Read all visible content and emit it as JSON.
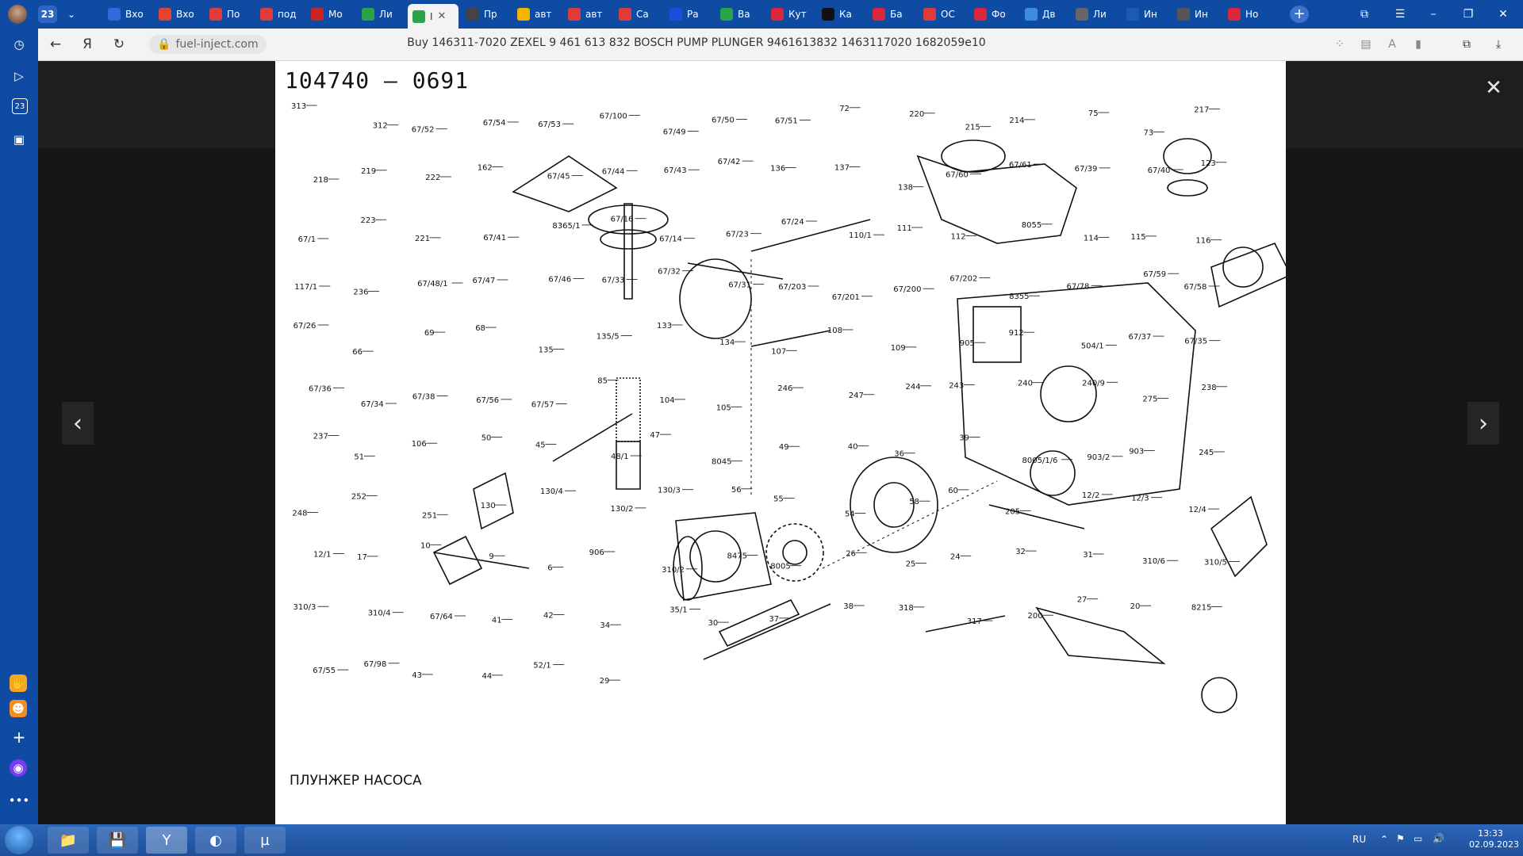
{
  "browser": {
    "tab_count": "23",
    "tabs": [
      {
        "label": "Вхо",
        "color": "#2f6bd8",
        "icon": "mail-icon"
      },
      {
        "label": "Вхо",
        "color": "#e2442f",
        "icon": "gmail-icon"
      },
      {
        "label": "По",
        "color": "#e03b3b",
        "icon": "flag-icon"
      },
      {
        "label": "под",
        "color": "#e03b3b",
        "icon": "yandex-icon"
      },
      {
        "label": "Мо",
        "color": "#c22",
        "icon": "news-icon"
      },
      {
        "label": "Ли",
        "color": "#2aa34a",
        "icon": "people-icon"
      },
      {
        "label": "I",
        "color": "#2aa34a",
        "icon": "leaf-icon",
        "active": true
      },
      {
        "label": "Пр",
        "color": "#444",
        "icon": "doc-icon"
      },
      {
        "label": "авт",
        "color": "#f2b600",
        "icon": "chart-icon"
      },
      {
        "label": "авт",
        "color": "#e03b3b",
        "icon": "yandex-icon"
      },
      {
        "label": "Са",
        "color": "#e03b3b",
        "icon": "map-pin-icon"
      },
      {
        "label": "Ра",
        "color": "#1c4ed8",
        "icon": "a-icon"
      },
      {
        "label": "Ва",
        "color": "#2aa34a",
        "icon": "link-icon"
      },
      {
        "label": "Кут",
        "color": "#d8263b",
        "icon": "play-icon"
      },
      {
        "label": "Ка",
        "color": "#111",
        "icon": "star-icon"
      },
      {
        "label": "Ба",
        "color": "#d8263b",
        "icon": "pen-icon"
      },
      {
        "label": "ОС",
        "color": "#e03b3b",
        "icon": "yandex-icon"
      },
      {
        "label": "Фо",
        "color": "#d8263b",
        "icon": "photo-icon"
      },
      {
        "label": "Дв",
        "color": "#3a8de0",
        "icon": "arrow-icon"
      },
      {
        "label": "Ли",
        "color": "#666",
        "icon": "location-icon"
      },
      {
        "label": "Ин",
        "color": "#1a5ab8",
        "icon": "f-icon"
      },
      {
        "label": "Ин",
        "color": "#555",
        "icon": "speaker-icon"
      },
      {
        "label": "Но",
        "color": "#d8263b",
        "icon": "d-icon"
      }
    ],
    "url": "fuel-inject.com",
    "page_title": "Buy 146311-7020 ZEXEL 9 461 613 832 BOSCH PUMP PLUNGER 9461613832 1463117020 1682059e10"
  },
  "sidebar": {
    "badge": "23"
  },
  "viewer": {
    "diagram_title": "104740 — 0691",
    "caption": "ПЛУНЖЕР НАСОСА",
    "part_labels": [
      "313",
      "312",
      "67/52",
      "67/54",
      "67/53",
      "67/100",
      "67/49",
      "67/50",
      "67/51",
      "72",
      "220",
      "215",
      "214",
      "75",
      "73",
      "217",
      "218",
      "219",
      "222",
      "162",
      "67/45",
      "67/44",
      "67/43",
      "67/42",
      "136",
      "137",
      "138",
      "67/60",
      "67/61",
      "67/39",
      "67/40",
      "123",
      "67/1",
      "223",
      "221",
      "67/41",
      "8365/1",
      "67/16",
      "67/14",
      "67/23",
      "67/24",
      "110/1",
      "111",
      "112",
      "8055",
      "114",
      "115",
      "116",
      "117/1",
      "236",
      "67/48/1",
      "67/47",
      "67/46",
      "67/33",
      "67/32",
      "67/31",
      "67/203",
      "67/201",
      "67/200",
      "67/202",
      "8355",
      "67/78",
      "67/59",
      "67/58",
      "67/26",
      "66",
      "69",
      "68",
      "135",
      "135/5",
      "133",
      "134",
      "107",
      "108",
      "109",
      "905",
      "912",
      "504/1",
      "67/37",
      "67/35",
      "67/36",
      "67/34",
      "67/38",
      "67/56",
      "67/57",
      "85",
      "104",
      "105",
      "246",
      "247",
      "244",
      "243",
      "240",
      "240/9",
      "275",
      "238",
      "237",
      "51",
      "106",
      "50",
      "45",
      "48/1",
      "47",
      "8045",
      "49",
      "40",
      "36",
      "39",
      "8005/1/6",
      "903/2",
      "903",
      "245",
      "248",
      "252",
      "251",
      "130",
      "130/4",
      "130/2",
      "130/3",
      "56",
      "55",
      "54",
      "58",
      "60",
      "205",
      "12/2",
      "12/3",
      "12/4",
      "12/1",
      "17",
      "10",
      "9",
      "6",
      "906",
      "310/2",
      "8475",
      "8005",
      "26",
      "25",
      "24",
      "32",
      "31",
      "310/6",
      "310/5",
      "310/3",
      "310/4",
      "67/64",
      "41",
      "42",
      "34",
      "35/1",
      "30",
      "37",
      "38",
      "318",
      "317",
      "200",
      "27",
      "20",
      "8215",
      "67/55",
      "67/98",
      "43",
      "44",
      "52/1",
      "29"
    ]
  },
  "taskbar": {
    "language": "RU",
    "time": "13:33",
    "date": "02.09.2023"
  }
}
